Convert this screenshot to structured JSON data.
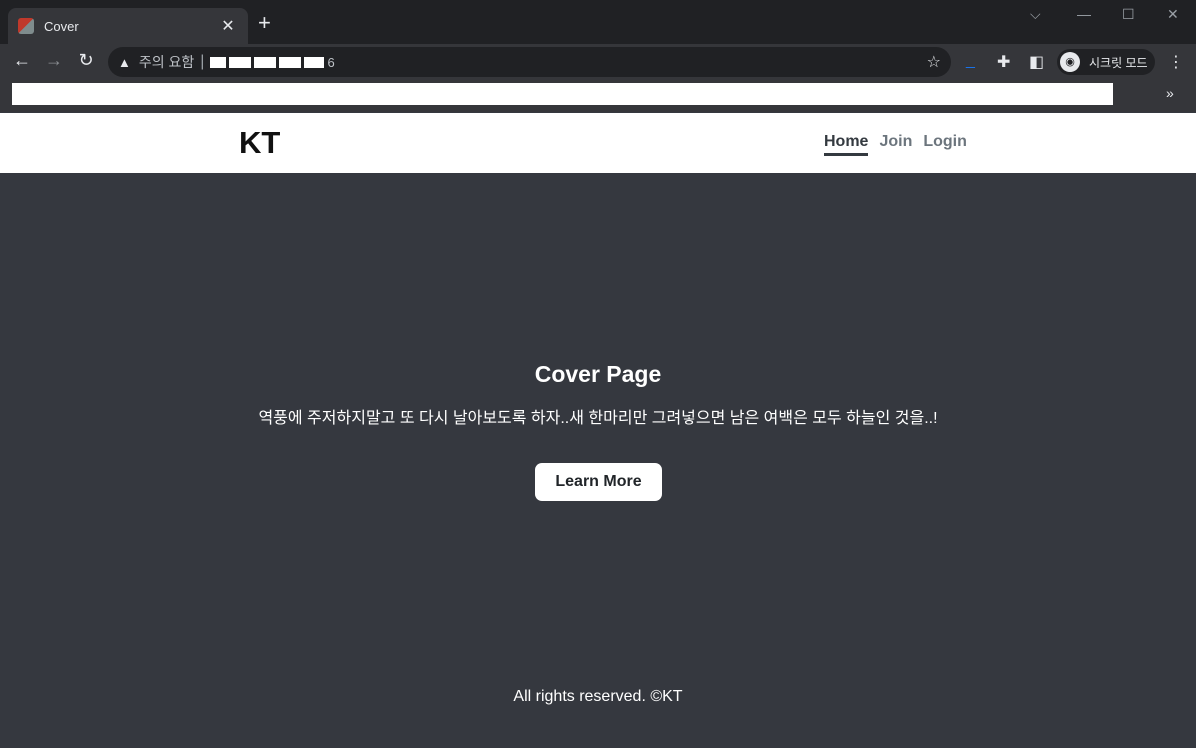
{
  "browser": {
    "tab_title": "Cover",
    "tab_close": "✕",
    "new_tab": "+",
    "omnibox": {
      "warning_label": "주의 요함",
      "url_tail": "6"
    },
    "incognito_label": "시크릿 모드",
    "bookmark_more": "»"
  },
  "site": {
    "brand": "KT",
    "nav": [
      {
        "label": "Home",
        "active": true
      },
      {
        "label": "Join",
        "active": false
      },
      {
        "label": "Login",
        "active": false
      }
    ],
    "cover": {
      "title": "Cover Page",
      "lead": "역풍에 주저하지말고 또 다시 날아보도록 하자..새 한마리만 그려넣으면 남은 여백은 모두 하늘인 것을..!",
      "button_label": "Learn More"
    },
    "footer": "All rights reserved. ©KT"
  }
}
